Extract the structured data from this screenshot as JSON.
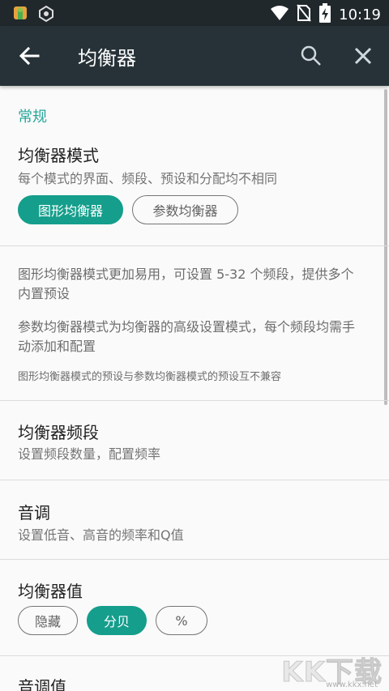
{
  "status_bar": {
    "time": "10:19",
    "left_icons": [
      "android-debug-icon",
      "molecule-app-icon"
    ],
    "right_icons": [
      "wifi-icon",
      "no-sim-icon",
      "battery-charging-icon"
    ]
  },
  "app_bar": {
    "title": "均衡器",
    "back_icon": "arrow-back-icon",
    "actions": [
      "search-icon",
      "close-icon"
    ]
  },
  "section": {
    "header": "常规"
  },
  "eq_mode": {
    "title": "均衡器模式",
    "summary": "每个模式的界面、频段、预设和分配均不相同",
    "options": [
      {
        "label": "图形均衡器",
        "selected": true
      },
      {
        "label": "参数均衡器",
        "selected": false
      }
    ]
  },
  "info": {
    "para1": "图形均衡器模式更加易用，可设置 5-32 个频段，提供多个内置预设",
    "para2": "参数均衡器模式为均衡器的高级设置模式，每个频段均需手动添加和配置",
    "note": "图形均衡器模式的预设与参数均衡器模式的预设互不兼容"
  },
  "eq_bands": {
    "title": "均衡器频段",
    "summary": "设置频段数量，配置频率"
  },
  "tone": {
    "title": "音调",
    "summary": "设置低音、高音的频率和Q值"
  },
  "eq_values": {
    "title": "均衡器值",
    "options": [
      {
        "label": "隐藏",
        "selected": false
      },
      {
        "label": "分贝",
        "selected": true
      },
      {
        "label": "%",
        "selected": false
      }
    ]
  },
  "tone_values": {
    "title": "音调值"
  },
  "watermark": {
    "big": "KK下载",
    "small": "www.kkx.net"
  },
  "colors": {
    "accent": "#159e8c",
    "section_header": "#26a69a",
    "app_bar": "#263238",
    "status_bar": "#20282c"
  }
}
